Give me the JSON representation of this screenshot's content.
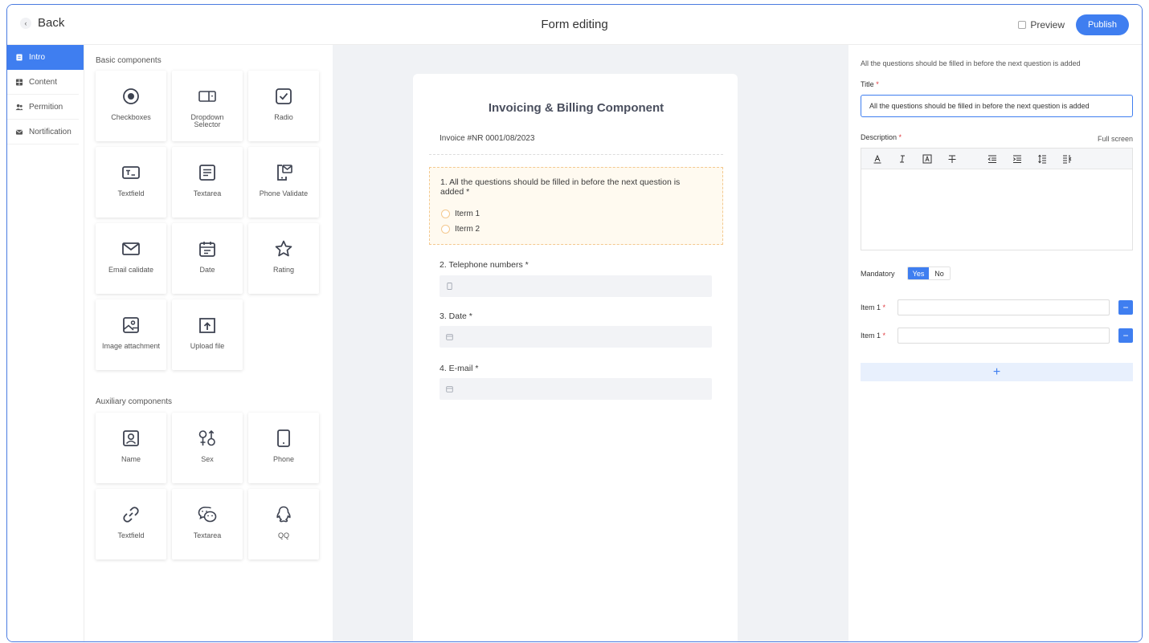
{
  "header": {
    "back_label": "Back",
    "page_title": "Form editing",
    "preview_label": "Preview",
    "publish_label": "Publish"
  },
  "nav": {
    "items": [
      {
        "label": "Intro",
        "active": true
      },
      {
        "label": "Content"
      },
      {
        "label": "Permition"
      },
      {
        "label": "Nortification"
      }
    ]
  },
  "palette": {
    "basic_title": "Basic components",
    "basic": [
      {
        "label": "Checkboxes",
        "icon": "radio-dot-icon"
      },
      {
        "label": "Dropdown Selector",
        "icon": "dropdown-icon"
      },
      {
        "label": "Radio",
        "icon": "checkbox-icon"
      },
      {
        "label": "Textfield",
        "icon": "textfield-icon"
      },
      {
        "label": "Textarea",
        "icon": "textarea-icon"
      },
      {
        "label": "Phone Validate",
        "icon": "phone-validate-icon"
      },
      {
        "label": "Email calidate",
        "icon": "mail-icon"
      },
      {
        "label": "Date",
        "icon": "calendar-icon"
      },
      {
        "label": "Rating",
        "icon": "star-icon"
      },
      {
        "label": "Image attachment",
        "icon": "image-icon"
      },
      {
        "label": "Upload file",
        "icon": "upload-icon"
      }
    ],
    "aux_title": "Auxiliary components",
    "aux": [
      {
        "label": "Name",
        "icon": "person-icon"
      },
      {
        "label": "Sex",
        "icon": "gender-icon"
      },
      {
        "label": "Phone",
        "icon": "phone-icon"
      },
      {
        "label": "Textfield",
        "icon": "link-icon"
      },
      {
        "label": "Textarea",
        "icon": "wechat-icon"
      },
      {
        "label": "QQ",
        "icon": "qq-icon"
      }
    ]
  },
  "form": {
    "title": "Invoicing & Billing Component",
    "invoice": "Invoice #NR 0001/08/2023",
    "q1": {
      "text": "1. All the questions should be filled in before the next question is added *",
      "options": [
        "Iterm 1",
        "Iterm 2"
      ]
    },
    "q2": {
      "text": "2. Telephone numbers *"
    },
    "q3": {
      "text": "3. Date *"
    },
    "q4": {
      "text": "4. E-mail *"
    }
  },
  "props": {
    "hint": "All the questions should be filled in before the next question is added",
    "title_label": "Title",
    "title_value": "All the questions should be filled in before the next question is added",
    "description_label": "Description",
    "fullscreen_label": "Full screen",
    "mandatory_label": "Mandatory",
    "yes_label": "Yes",
    "no_label": "No",
    "mandatory_value": "Yes",
    "item1_label": "Item 1",
    "item2_label": "Item 1",
    "required_mark": "*",
    "minus_label": "−",
    "add_label": "+"
  },
  "colors": {
    "accent": "#3f7ef0",
    "highlight_bg": "#fffaf0",
    "required": "#e0393e"
  }
}
